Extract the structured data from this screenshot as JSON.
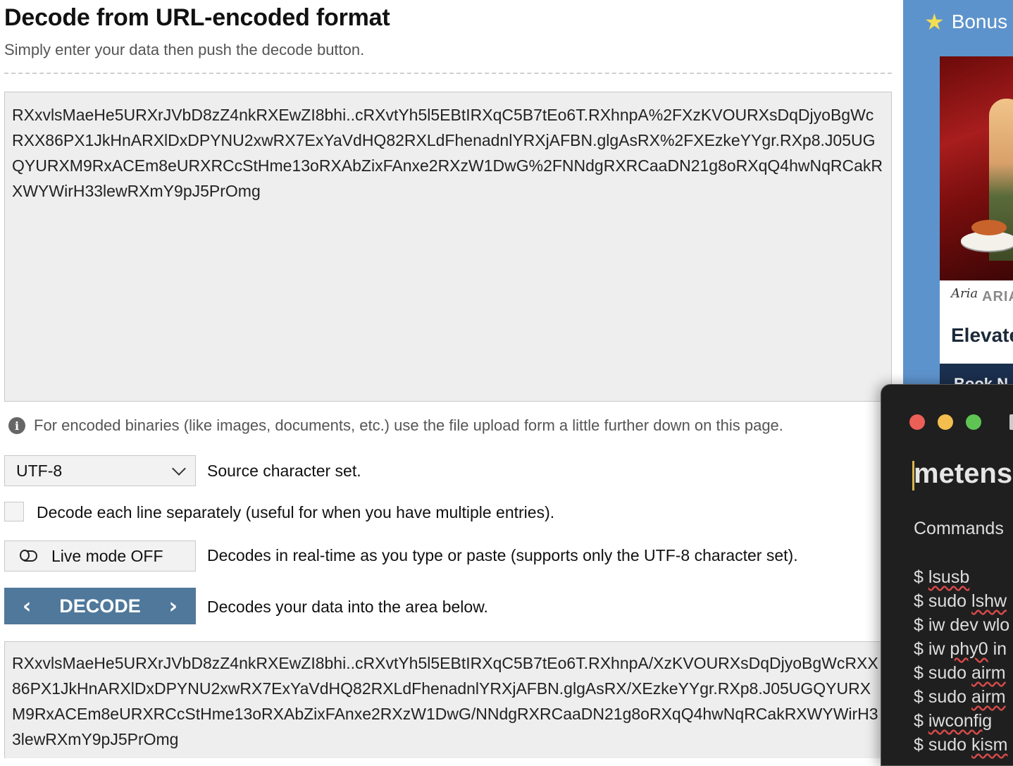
{
  "page": {
    "title": "Decode from URL-encoded format",
    "subtitle": "Simply enter your data then push the decode button."
  },
  "input": {
    "value": "RXxvlsMaeHe5URXrJVbD8zZ4nkRXEwZI8bhi..cRXvtYh5l5EBtIRXqC5B7tEo6T.RXhnpA%2FXzKVOURXsDqDjyoBgWcRXX86PX1JkHnARXlDxDPYNU2xwRX7ExYaVdHQ82RXLdFhenadnlYRXjAFBN.glgAsRX%2FXEzkeYYgr.RXp8.J05UGQYURXM9RxACEm8eURXRCcStHme13oRXAbZixFAnxe2RXzW1DwG%2FNNdgRXRCaaDN21g8oRXqQ4hwNqRCakRXWYWirH33lewRXmY9pJ5PrOmg"
  },
  "info_text": "For encoded binaries (like images, documents, etc.) use the file upload form a little further down on this page.",
  "charset": {
    "selected": "UTF-8",
    "label": "Source character set."
  },
  "line_option": {
    "label": "Decode each line separately (useful for when you have multiple entries)."
  },
  "live_mode": {
    "button_label": "Live mode OFF",
    "label": "Decodes in real-time as you type or paste (supports only the UTF-8 character set)."
  },
  "decode": {
    "button_label": "DECODE",
    "label": "Decodes your data into the area below."
  },
  "output": {
    "value": "RXxvlsMaeHe5URXrJVbD8zZ4nkRXEwZI8bhi..cRXvtYh5l5EBtIRXqC5B7tEo6T.RXhnpA/XzKVOURXsDqDjyoBgWcRXX86PX1JkHnARXlDxDPYNU2xwRX7ExYaVdHQ82RXLdFhenadnlYRXjAFBN.glgAsRX/XEzkeYYgr.RXp8.J05UGQYURXM9RxACEm8eURXRCcStHme13oRXAbZixFAnxe2RXzW1DwG/NNdgRXRCaaDN21g8oRXqQ4hwNqRCakRXWYWirH33lewRXmY9pJ5PrOmg"
  },
  "sidebar": {
    "bonus_label": "Bonus",
    "ad": {
      "logo_text": "Aria",
      "brand": "ARIA",
      "headline": "Elevate",
      "cta": "Book N"
    }
  },
  "terminal": {
    "title": "metens",
    "subtitle": "Commands",
    "lines": [
      "$ lsusb",
      "$ sudo lshw",
      "$ iw dev wlo",
      "$ iw phy0 in",
      "$ sudo airm",
      "$ sudo airm",
      "$ iwconfig",
      "$ sudo kism"
    ]
  },
  "colors": {
    "decode_button": "#4f789b",
    "sidebar": "#5d93cc",
    "terminal_bg": "#1f1f1f"
  }
}
